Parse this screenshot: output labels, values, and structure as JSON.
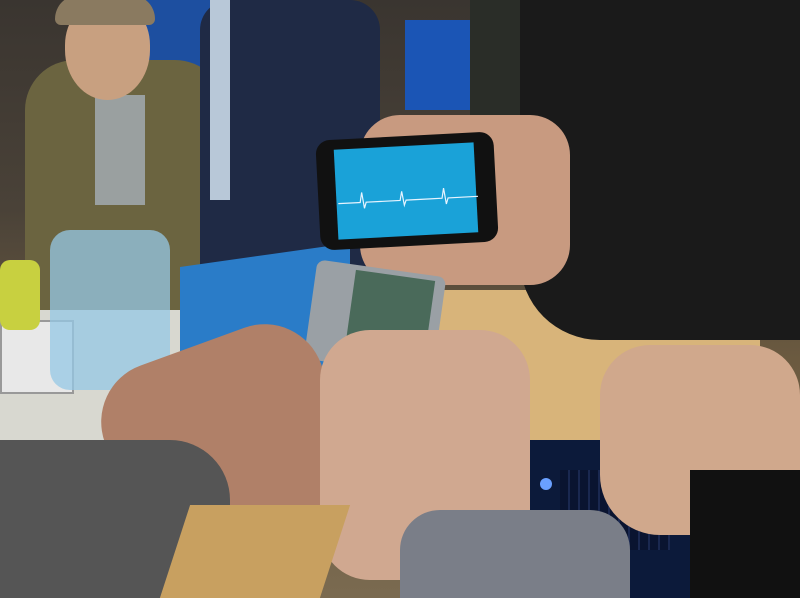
{
  "photo": {
    "colors": {
      "room": "#4a4238",
      "jacket": "#6b6440",
      "suit": "#1f2a45",
      "phone_screen": "#1aa2d8",
      "ecg_trace": "#e8f4ff",
      "box_blue": "#2a7cc8",
      "skin": "#c89a80",
      "laptop": "#0c1a3a"
    }
  }
}
